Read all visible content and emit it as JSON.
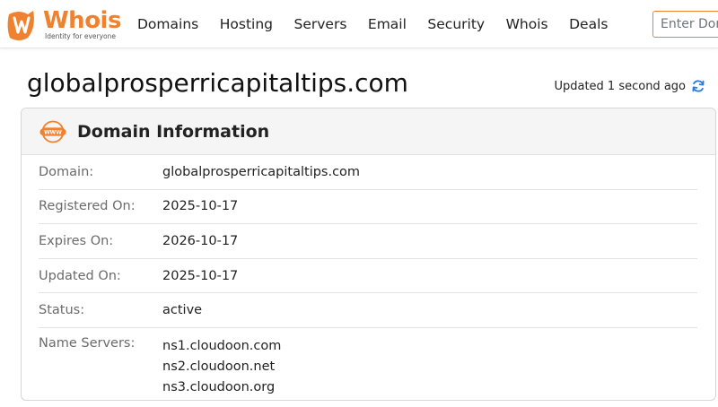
{
  "brand": {
    "name": "Whois",
    "tagline": "Identity for everyone",
    "accent_color": "#f0812f"
  },
  "nav": {
    "items": [
      {
        "label": "Domains"
      },
      {
        "label": "Hosting"
      },
      {
        "label": "Servers"
      },
      {
        "label": "Email"
      },
      {
        "label": "Security"
      },
      {
        "label": "Whois"
      },
      {
        "label": "Deals"
      }
    ]
  },
  "search": {
    "placeholder": "Enter Domain or IP"
  },
  "page": {
    "title": "globalprosperricapitaltips.com",
    "updated_text": "Updated 1 second ago",
    "refresh_icon": "refresh-icon"
  },
  "card": {
    "icon": "www-icon",
    "title": "Domain Information",
    "rows": [
      {
        "label": "Domain:",
        "value": "globalprosperricapitaltips.com"
      },
      {
        "label": "Registered On:",
        "value": "2025-10-17"
      },
      {
        "label": "Expires On:",
        "value": "2026-10-17"
      },
      {
        "label": "Updated On:",
        "value": "2025-10-17"
      },
      {
        "label": "Status:",
        "value": "active"
      }
    ],
    "name_servers": {
      "label": "Name Servers:",
      "values": [
        "ns1.cloudoon.com",
        "ns2.cloudoon.net",
        "ns3.cloudoon.org"
      ]
    }
  }
}
